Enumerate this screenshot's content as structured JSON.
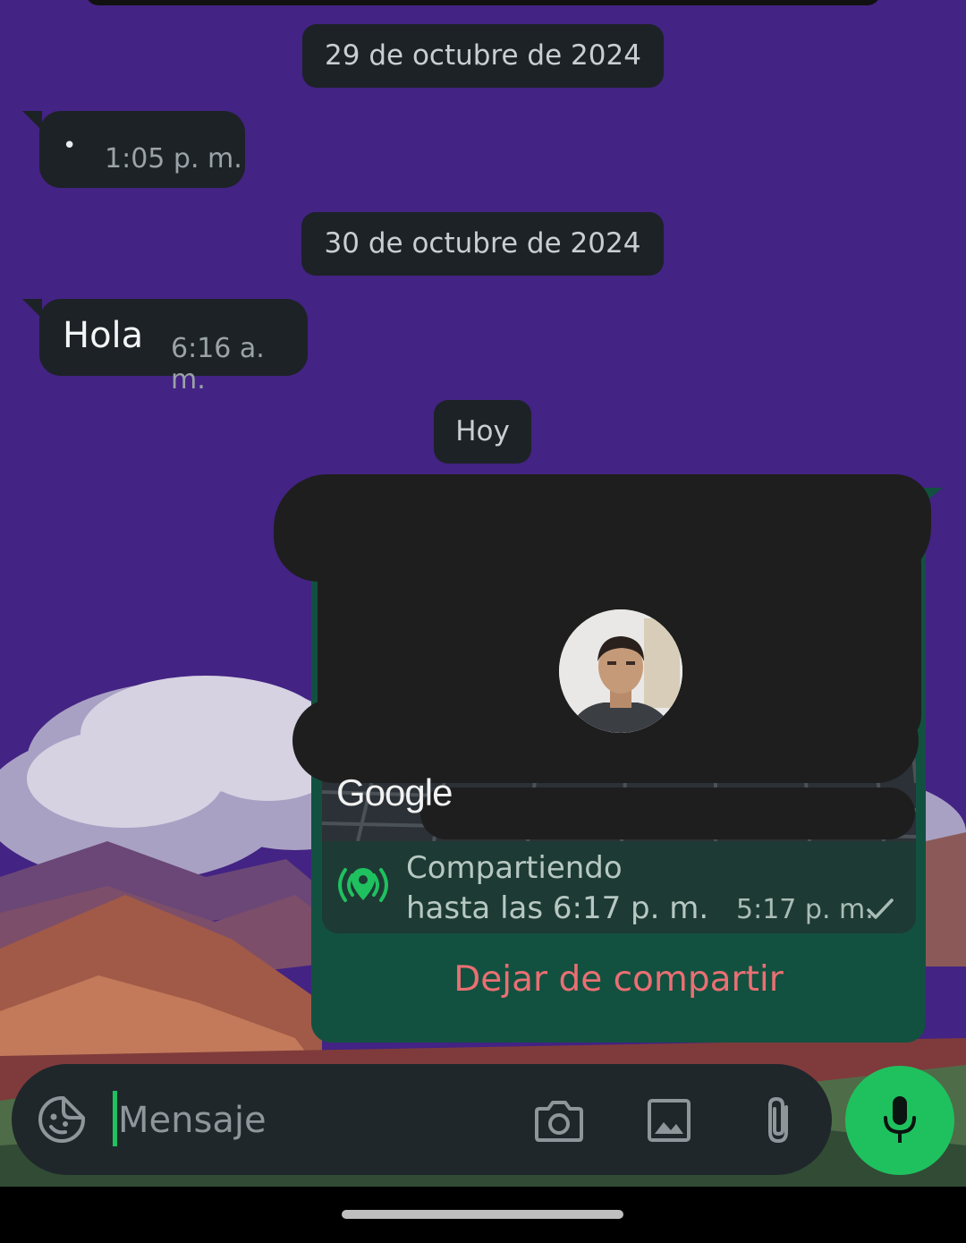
{
  "messages": {
    "date_1": "29 de octubre de 2024",
    "msg_1": {
      "text": "•",
      "time": "1:05 p. m."
    },
    "date_2": "30 de octubre de 2024",
    "msg_2": {
      "text": "Hola",
      "time": "6:16 a. m."
    },
    "date_3": "Hoy",
    "location": {
      "map_brand": "Google",
      "status_line1": "Compartiendo",
      "status_line2": "hasta las 6:17 p. m.",
      "time": "5:17 p. m.",
      "stop_label": "Dejar de compartir"
    }
  },
  "composer": {
    "placeholder": "Mensaje"
  },
  "icons": {
    "emoji": "sticker-icon",
    "camera": "camera-icon",
    "gallery": "gallery-icon",
    "attach": "paperclip-icon",
    "mic": "microphone-icon",
    "live_location": "live-location-icon",
    "sent_tick": "check-icon"
  },
  "colors": {
    "chat_background": "#432383",
    "outgoing_bubble": "#125140",
    "incoming_bubble": "#1d2226",
    "accent_green": "#1fc15f",
    "stop_red": "#ea6f73"
  }
}
